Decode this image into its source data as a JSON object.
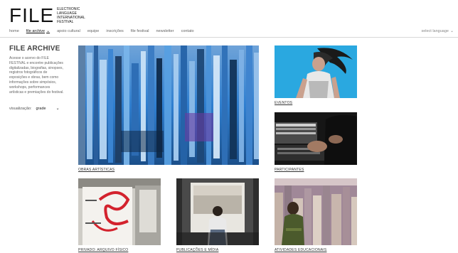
{
  "brand": {
    "logo": "FILE",
    "lines": [
      "ELECTRONIC",
      "LANGUAGE",
      "INTERNATIONAL",
      "FESTIVAL"
    ]
  },
  "nav": {
    "items": [
      "home",
      "file archive",
      "apoio cultural",
      "equipe",
      "inscrições",
      "file festival",
      "newsletter",
      "contato"
    ],
    "language": "select language"
  },
  "sidebar": {
    "title": "FILE ARCHIVE",
    "description": "Acesse o acervo do FILE FESTIVAL e encontre publicações digitalizadas, biografias, sinopses, registros fotográficos de exposições e obras, bem como informações sobre simpósios, workshops, performances artísticas e premiações do festival.",
    "view_label": "visualização:",
    "view_value": "grade"
  },
  "cards": [
    {
      "label": "OBRAS ARTÍSTICAS"
    },
    {
      "label": "EVENTOS"
    },
    {
      "label": "PARTICIPANTES"
    },
    {
      "label": "PRIVADO: ARQUIVO FÍSICO"
    },
    {
      "label": "PUBLICAÇÕES E MÍDIA"
    },
    {
      "label": "ATIVIDADES EDUCACIONAIS"
    }
  ],
  "colors": {
    "accent_blue": "#29a9e1",
    "text_dark": "#222222",
    "text_muted": "#666666"
  }
}
